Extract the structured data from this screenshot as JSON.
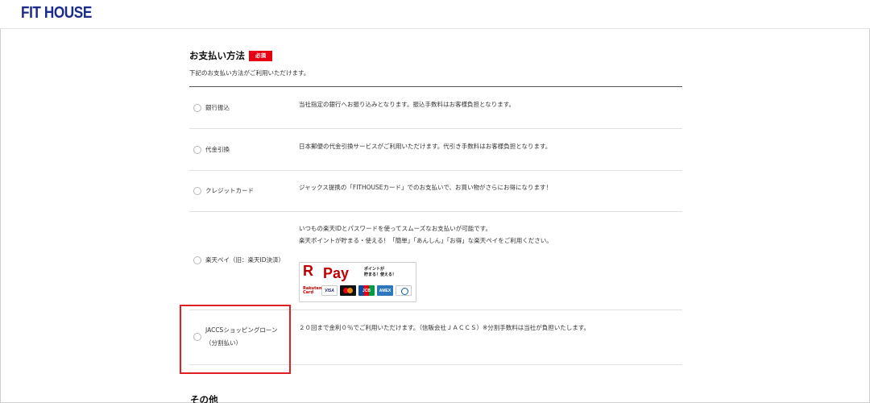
{
  "header": {
    "logo_text": "FIT HOUSE"
  },
  "payment": {
    "title": "お支払い方法",
    "required_badge": "必須",
    "description": "下記のお支払い方法がご利用いただけます。",
    "options": [
      {
        "label": "銀行振込",
        "description": [
          "当社指定の銀行へお振り込みとなります。振込手数料はお客様負担となります。"
        ]
      },
      {
        "label": "代金引換",
        "description": [
          "日本郵便の代金引換サービスがご利用いただけます。代引き手数料はお客様負担となります。"
        ]
      },
      {
        "label": "クレジットカード",
        "description": [
          "ジャックス提携の「FITHOUSEカード」でのお支払いで、お買い物がさらにお得になります！"
        ]
      },
      {
        "label": "楽天ペイ（旧：楽天ID決済）",
        "description": [
          "いつもの楽天IDとパスワードを使ってスムーズなお支払いが可能です。",
          "楽天ポイントが貯まる・使える！「簡単」「あんしん」「お得」な楽天ペイをご利用ください。"
        ]
      },
      {
        "label_lines": [
          "JACCSショッピングローン",
          "（分割払い）"
        ],
        "description": [
          "２０回まで金利０％でご利用いただけます。（信販会社ＪＡＣＣＳ）※分割手数料は当社が負担いたします。"
        ]
      }
    ],
    "rakuten_logo": {
      "brand": "Pay",
      "r_mark": "R",
      "tagline_lines": [
        "ポイントが",
        "貯まる！使える！"
      ],
      "card_brand_lines": [
        "Rakuten",
        "Card"
      ],
      "card_icons": [
        "visa-icon",
        "mastercard-icon",
        "jcb-icon",
        "amex-icon",
        "diners-icon"
      ],
      "card_labels": {
        "visa": "VISA",
        "jcb": "JCB",
        "amex": "AMEX"
      }
    }
  },
  "next_section": {
    "title": "その他"
  },
  "colors": {
    "brand": "#1a2b8c",
    "required": "#e60012",
    "highlight": "#e02020",
    "rakuten": "#bf0000"
  }
}
